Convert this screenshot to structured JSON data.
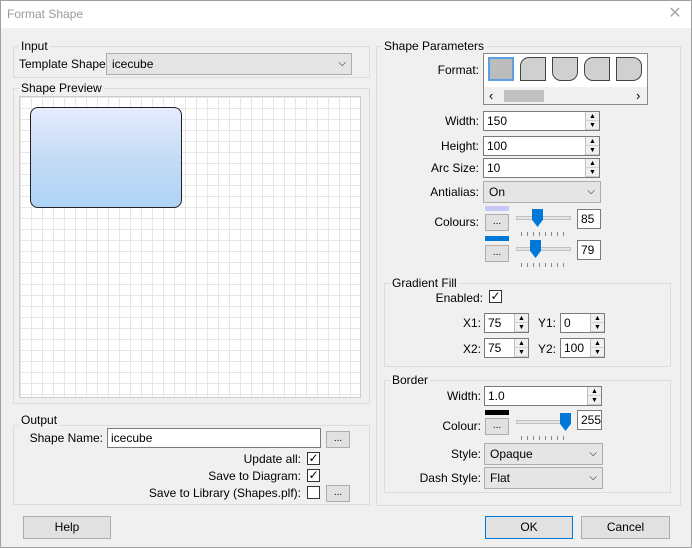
{
  "window": {
    "title": "Format Shape"
  },
  "input": {
    "group_title": "Input",
    "template_label": "Template Shape:",
    "template_value": "icecube"
  },
  "preview": {
    "group_title": "Shape Preview"
  },
  "output": {
    "group_title": "Output",
    "shape_name_label": "Shape Name:",
    "shape_name_value": "icecube",
    "update_all_label": "Update all:",
    "save_diagram_label": "Save to Diagram:",
    "save_library_label": "Save to Library (Shapes.plf):",
    "browse_label": "...",
    "update_all_checked": true,
    "save_diagram_checked": true,
    "save_library_checked": false
  },
  "params": {
    "group_title": "Shape Parameters",
    "format_label": "Format:",
    "width_label": "Width:",
    "width_value": "150",
    "height_label": "Height:",
    "height_value": "100",
    "arc_label": "Arc Size:",
    "arc_value": "10",
    "antialias_label": "Antialias:",
    "antialias_value": "On",
    "colours_label": "Colours:",
    "colour1_value": "85",
    "colour2_value": "79",
    "colour1_swatch": "#c8c8f8",
    "colour2_swatch": "#0078d7",
    "browse_label": "..."
  },
  "gradient": {
    "group_title": "Gradient Fill",
    "enabled_label": "Enabled:",
    "enabled_checked": true,
    "x1_label": "X1:",
    "x1_value": "75",
    "y1_label": "Y1:",
    "y1_value": "0",
    "x2_label": "X2:",
    "x2_value": "75",
    "y2_label": "Y2:",
    "y2_value": "100"
  },
  "border": {
    "group_title": "Border",
    "width_label": "Width:",
    "width_value": "1.0",
    "colour_label": "Colour:",
    "colour_value": "255",
    "colour_swatch": "#000000",
    "browse_label": "...",
    "style_label": "Style:",
    "style_value": "Opaque",
    "dash_label": "Dash Style:",
    "dash_value": "Flat"
  },
  "footer": {
    "help": "Help",
    "ok": "OK",
    "cancel": "Cancel"
  },
  "glyphs": {
    "close": "✕",
    "check": "✓",
    "dropdown": "⌵",
    "spin_up": "▲",
    "spin_down": "▼",
    "scroll_left": "‹",
    "scroll_right": "›"
  }
}
